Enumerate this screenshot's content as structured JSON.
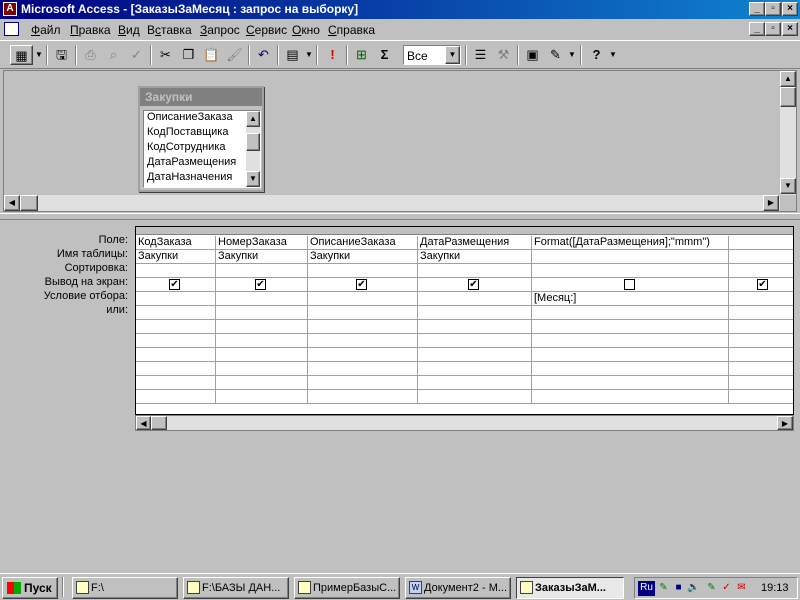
{
  "window": {
    "title": "Microsoft Access - [ЗаказыЗаМесяц : запрос на выборку]",
    "controls": [
      "_",
      "▫",
      "×"
    ]
  },
  "menu": {
    "items": [
      "Файл",
      "Правка",
      "Вид",
      "Вставка",
      "Запрос",
      "Сервис",
      "Окно",
      "Справка"
    ],
    "underlines": [
      "Ф",
      "П",
      "В",
      "с",
      "З",
      "С",
      "О",
      "С"
    ]
  },
  "toolbar": {
    "top_values_combo": "Все",
    "sigma_label": "Σ",
    "run_label": "!",
    "help_label": "?"
  },
  "table_window": {
    "title": "Закупки",
    "fields": [
      "ОписаниеЗаказа",
      "КодПоставщика",
      "КодСотрудника",
      "ДатаРазмещения",
      "ДатаНазначения"
    ]
  },
  "grid": {
    "row_labels": [
      "Поле:",
      "Имя таблицы:",
      "Сортировка:",
      "Вывод на экран:",
      "Условие отбора:",
      "или:"
    ],
    "columns": [
      {
        "field": "КодЗаказа",
        "table": "Закупки",
        "sort": "",
        "show": true,
        "criteria": "",
        "or": ""
      },
      {
        "field": "НомерЗаказа",
        "table": "Закупки",
        "sort": "",
        "show": true,
        "criteria": "",
        "or": ""
      },
      {
        "field": "ОписаниеЗаказа",
        "table": "Закупки",
        "sort": "",
        "show": true,
        "criteria": "",
        "or": ""
      },
      {
        "field": "ДатаРазмещения",
        "table": "Закупки",
        "sort": "",
        "show": true,
        "criteria": "",
        "or": ""
      },
      {
        "field": "Format([ДатаРазмещения];\"mmm\")",
        "table": "",
        "sort": "",
        "show": false,
        "criteria": "[Месяц:]",
        "or": ""
      },
      {
        "field": "",
        "table": "",
        "sort": "",
        "show": true,
        "criteria": "",
        "or": ""
      }
    ]
  },
  "taskbar": {
    "start_label": "Пуск",
    "tasks": [
      {
        "label": "F:\\",
        "active": false
      },
      {
        "label": "F:\\БАЗЫ ДАН...",
        "active": false
      },
      {
        "label": "ПримерБазыС...",
        "active": false
      },
      {
        "label": "Документ2 - М...",
        "active": false
      },
      {
        "label": "ЗаказыЗаМ...",
        "active": true
      }
    ],
    "lang": "Ru",
    "clock": "19:13"
  }
}
